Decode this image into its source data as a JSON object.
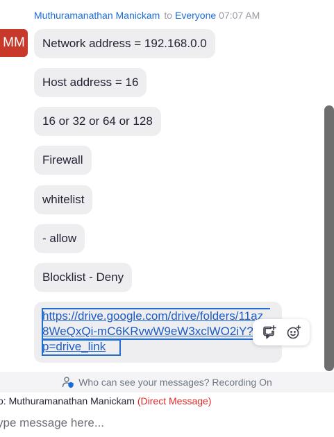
{
  "message": {
    "sender": "Muthuramanathan Manickam",
    "to_word": "to",
    "recipient": "Everyone",
    "time": "07:07 AM",
    "avatar_initials": "MM",
    "avatar_color": "#c9392b",
    "bubbles": [
      "Network address = 192.168.0.0",
      "Host address = 16",
      "16 or 32 or 64 or 128",
      "Firewall",
      "whitelist",
      "- allow",
      "Blocklist - Deny"
    ],
    "link": "https://drive.google.com/drive/folders/11az_8WeQxQi-mC6KRvwW9eW3xclWO2iY?usp=drive_link"
  },
  "hover_actions": [
    {
      "icon": "reply-thread-icon"
    },
    {
      "icon": "add-reaction-icon"
    }
  ],
  "privacy": {
    "icon": "user-privacy-icon",
    "text": "Who can see your messages? Recording On"
  },
  "compose": {
    "to_label": "o:",
    "to_name": "Muthuramanathan Manickam",
    "direct_message": "(Direct Message)",
    "placeholder": "ype message here..."
  },
  "colors": {
    "link": "#1a5bc4",
    "sender": "#1a6bd6",
    "direct_message": "#e02828",
    "bubble_bg": "#eeeef1"
  }
}
